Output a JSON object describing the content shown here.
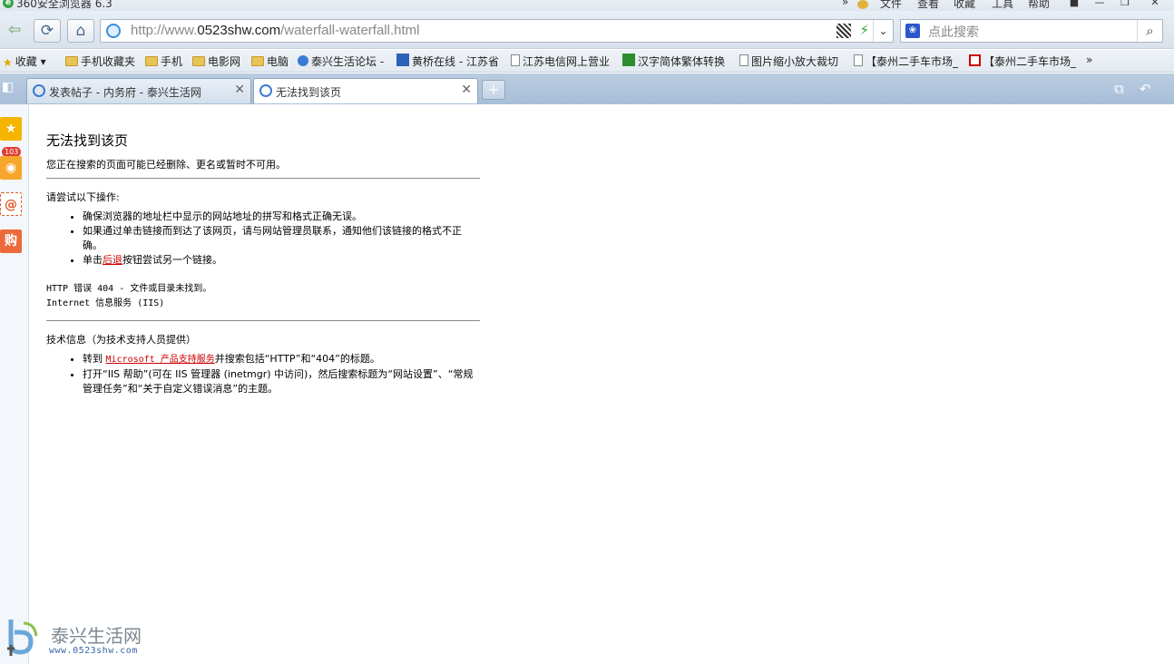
{
  "window": {
    "title": "360安全浏览器 6.3",
    "menu": [
      "»",
      "文件",
      "查看",
      "收藏",
      "工具",
      "帮助"
    ]
  },
  "nav": {
    "url_prefix": "http://www.",
    "url_domain": "0523shw.com",
    "url_path": "/waterfall-waterfall.html",
    "search_placeholder": "点此搜索"
  },
  "bookmarks": [
    "收藏",
    "手机收藏夹",
    "手机",
    "电影网",
    "电脑",
    "泰兴生活论坛 -",
    "黄桥在线 - 江苏省",
    "江苏电信网上营业",
    "汉字简体繁体转换",
    "图片缩小放大裁切",
    "【泰州二手车市场_",
    "【泰州二手车市场_"
  ],
  "tabs": [
    {
      "label": "发表帖子 - 内务府 - 泰兴生活网"
    },
    {
      "label": "无法找到该页"
    }
  ],
  "sidebar": {
    "weibo_badge": "103",
    "shop_label": "购"
  },
  "page": {
    "title": "无法找到该页",
    "subtitle": "您正在搜索的页面可能已经删除、更名或暂时不可用。",
    "try_heading": "请尝试以下操作:",
    "try_items": [
      "确保浏览器的地址栏中显示的网站地址的拼写和格式正确无误。",
      "如果通过单击链接而到达了该网页，请与网站管理员联系，通知他们该链接的格式不正确。"
    ],
    "back_prefix": "单击",
    "back_link": "后退",
    "back_suffix": "按钮尝试另一个链接。",
    "error_line": "HTTP 错误 404 - 文件或目录未找到。",
    "server_line": "Internet 信息服务 (IIS)",
    "tech_heading": "技术信息（为技术支持人员提供）",
    "tech_goto_prefix": "转到",
    "tech_link": "Microsoft 产品支持服务",
    "tech_goto_suffix": "并搜索包括“HTTP”和“404”的标题。",
    "tech_item2": "打开“IIS 帮助”(可在 IIS 管理器 (inetmgr) 中访问)，然后搜索标题为“网站设置”、“常规管理任务”和“关于自定义错误消息”的主题。"
  },
  "watermark": {
    "name": "泰兴生活网",
    "site": "www.0523shw.com"
  }
}
